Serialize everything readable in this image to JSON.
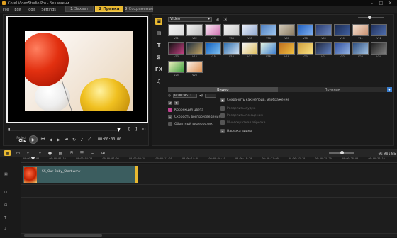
{
  "titlebar": {
    "title": "Corel VideoStudio Pro - Без имени"
  },
  "menu": [
    "File",
    "Edit",
    "Tools",
    "Settings"
  ],
  "steps": [
    {
      "n": "1",
      "label": "Захват",
      "active": false
    },
    {
      "n": "2",
      "label": "Правка",
      "active": true
    },
    {
      "n": "3",
      "label": "Сохранение",
      "active": false
    }
  ],
  "player": {
    "project_label": "Project",
    "clip_label": "Clip",
    "timecode": "00:00:00:00",
    "mark_in": "[",
    "mark_out": "]"
  },
  "library": {
    "category": "Video",
    "thumbs": [
      {
        "cap": "V01",
        "c1": "#f4f4f4",
        "c2": "#d8d8d8"
      },
      {
        "cap": "V02",
        "c1": "#f0f0f0",
        "c2": "#bcbcbc"
      },
      {
        "cap": "V03",
        "c1": "#f8e8f4",
        "c2": "#d070b0"
      },
      {
        "cap": "V04",
        "c1": "#f4f4f4",
        "c2": "#c8c8c8"
      },
      {
        "cap": "V05",
        "c1": "#e8eef8",
        "c2": "#90a8d0"
      },
      {
        "cap": "V06",
        "c1": "#5080c0",
        "c2": "#a0c8f0"
      },
      {
        "cap": "V07",
        "c1": "#d0c8b8",
        "c2": "#8a7a60"
      },
      {
        "cap": "V08",
        "c1": "#2060c0",
        "c2": "#80b0f0"
      },
      {
        "cap": "V09",
        "c1": "#2a3c70",
        "c2": "#6c88c0"
      },
      {
        "cap": "V10",
        "c1": "#1a2a50",
        "c2": "#4060a0"
      },
      {
        "cap": "V11",
        "c1": "#f4e0d0",
        "c2": "#c89070"
      },
      {
        "cap": "V12",
        "c1": "#20305a",
        "c2": "#5070b0"
      },
      {
        "cap": "V13",
        "c1": "#101010",
        "c2": "#c04080"
      },
      {
        "cap": "V14",
        "c1": "#203040",
        "c2": "#c0a060"
      },
      {
        "cap": "V15",
        "c1": "#1060c0",
        "c2": "#80c0f0"
      },
      {
        "cap": "V16",
        "c1": "#3070b0",
        "c2": "#d0e0f0"
      },
      {
        "cap": "V17",
        "c1": "#f4f4f4",
        "c2": "#e0c060"
      },
      {
        "cap": "V18",
        "c1": "#e0f0e0",
        "c2": "#4080d0"
      },
      {
        "cap": "V19",
        "c1": "#c07020",
        "c2": "#f0c040"
      },
      {
        "cap": "V20",
        "c1": "#d0a040",
        "c2": "#f8e080"
      },
      {
        "cap": "V21",
        "c1": "#202840",
        "c2": "#6080c0"
      },
      {
        "cap": "V22",
        "c1": "#3050a0",
        "c2": "#90b0e0"
      },
      {
        "cap": "V23",
        "c1": "#305080",
        "c2": "#a0c0e0"
      },
      {
        "cap": "V24",
        "c1": "#202020",
        "c2": "#808080"
      },
      {
        "cap": "V25",
        "c1": "#f0f0c0",
        "c2": "#40a040"
      },
      {
        "cap": "V26",
        "c1": "#f8f0e8",
        "c2": "#e09050"
      }
    ],
    "options_tabs": {
      "video": "Видео",
      "attribute": "Признак"
    },
    "options": {
      "duration": "0:00:05:1",
      "color_correction": "Коррекция цвета",
      "playback_speed": "Скорость воспроизведения",
      "reverse_video": "Обратный видеоролик",
      "save_snapshot": "Сохранить как неподв. изображение",
      "split_audio": "Разделить аудио",
      "split_by_scene": "Разделить по сценам",
      "multi_trim": "Многократная обрезка",
      "cut_video": "Нарезка видео"
    }
  },
  "timeline": {
    "timecode": "0:00:05:15",
    "ruler": [
      "00:00:00:00",
      "00:00:02:10",
      "00:00:04:20",
      "00:00:07:00",
      "00:00:09:10",
      "00:00:11:20",
      "00:00:14:00",
      "00:00:16:10",
      "00:00:18:20",
      "00:00:21:00",
      "00:00:23:10",
      "00:00:25:20",
      "00:00:28:00",
      "00:00:30:10"
    ],
    "clip_name": "SS_Our Baby_Start.wmv"
  },
  "icons": [
    "folder-icon",
    "media-icon",
    "title-icon",
    "transition-icon",
    "fx-icon",
    "audio-icon",
    "play-icon",
    "scissors-icon",
    "undo-icon",
    "redo-icon"
  ]
}
